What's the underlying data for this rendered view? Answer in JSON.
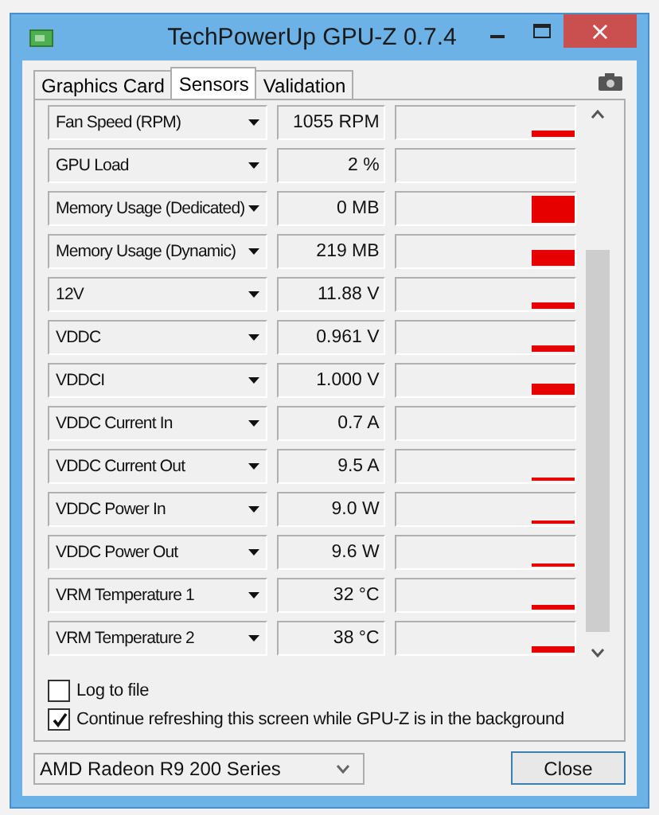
{
  "window": {
    "title": "TechPowerUp GPU-Z 0.7.4",
    "close": "×"
  },
  "tabs": [
    {
      "label": "Graphics Card",
      "selected": false
    },
    {
      "label": "Sensors",
      "selected": true
    },
    {
      "label": "Validation",
      "selected": false
    }
  ],
  "sensors": [
    {
      "name": "Fan Speed (RPM)",
      "value": "1055 RPM"
    },
    {
      "name": "GPU Load",
      "value": "2 %"
    },
    {
      "name": "Memory Usage (Dedicated)",
      "value": "0 MB"
    },
    {
      "name": "Memory Usage (Dynamic)",
      "value": "219 MB"
    },
    {
      "name": "12V",
      "value": "11.88 V"
    },
    {
      "name": "VDDC",
      "value": "0.961 V"
    },
    {
      "name": "VDDCI",
      "value": "1.000 V"
    },
    {
      "name": "VDDC Current In",
      "value": "0.7 A"
    },
    {
      "name": "VDDC Current Out",
      "value": "9.5 A"
    },
    {
      "name": "VDDC Power In",
      "value": "9.0 W"
    },
    {
      "name": "VDDC Power Out",
      "value": "9.6 W"
    },
    {
      "name": "VRM Temperature 1",
      "value": "32 °C"
    },
    {
      "name": "VRM Temperature 2",
      "value": "38 °C"
    }
  ],
  "options": [
    {
      "label": "Log to file",
      "checked": false
    },
    {
      "label": "Continue refreshing this screen while GPU-Z is in the background",
      "checked": true
    }
  ],
  "device": {
    "value": "AMD Radeon R9 200 Series"
  },
  "close_button": "Close"
}
